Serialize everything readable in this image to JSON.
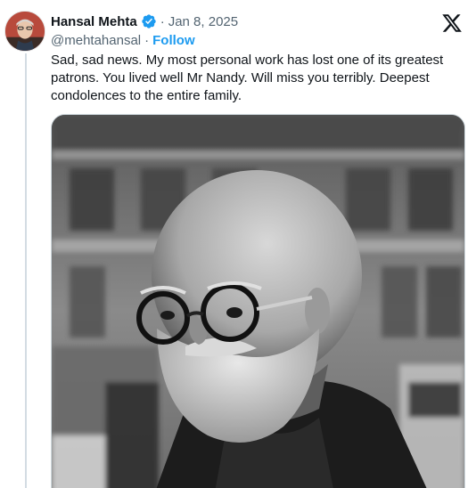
{
  "tweet": {
    "author_name": "Hansal Mehta",
    "separator": "·",
    "date": "Jan 8, 2025",
    "handle": "@mehtahansal",
    "handle_separator": "·",
    "follow_label": "Follow",
    "text": "Sad, sad news. My most personal work has lost one of its greatest patrons. You lived well Mr Nandy. Will miss you terribly. Deepest condolences to the entire family."
  },
  "icons": {
    "verified": "verified-badge-icon",
    "platform": "x-logo-icon"
  },
  "colors": {
    "accent": "#1d9bf0",
    "secondary_text": "#536471",
    "primary_text": "#0f1419",
    "thread_line": "#d3dce3"
  }
}
